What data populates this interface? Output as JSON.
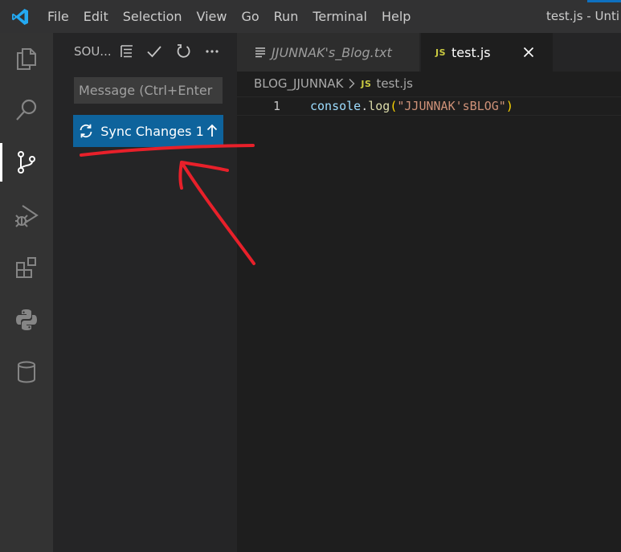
{
  "titlebar": {
    "menu": [
      "File",
      "Edit",
      "Selection",
      "View",
      "Go",
      "Run",
      "Terminal",
      "Help"
    ],
    "window_title": "test.js - Unti"
  },
  "activitybar": {
    "items": [
      "explorer-icon",
      "search-icon",
      "source-control-icon",
      "run-debug-icon",
      "extensions-icon",
      "python-icon",
      "database-icon"
    ],
    "active": "source-control-icon"
  },
  "sidebar": {
    "title": "SOU...",
    "actions": [
      "tree-view-icon",
      "commit-check-icon",
      "refresh-icon",
      "more-actions-icon"
    ],
    "commit_placeholder": "Message (Ctrl+Enter ...",
    "sync_label": "Sync Changes 1"
  },
  "editor": {
    "tabs": [
      {
        "label": "JJUNNAK's_Blog.txt",
        "icon": "text-file-icon",
        "active": false
      },
      {
        "label": "test.js",
        "icon": "JS",
        "active": true
      }
    ],
    "breadcrumb": {
      "folder": "BLOG_JJUNNAK",
      "file_icon": "JS",
      "file": "test.js"
    },
    "lines": [
      {
        "number": "1",
        "tokens": {
          "object": "console",
          "dot": ".",
          "fn": "log",
          "open": "(",
          "string": "\"JJUNNAK'sBLOG\"",
          "close": ")"
        }
      }
    ]
  },
  "colors": {
    "accent": "#0e639c",
    "annotation": "#e8202a",
    "activitybar": "#333333",
    "sidebar": "#252526",
    "editor": "#1e1e1e"
  }
}
